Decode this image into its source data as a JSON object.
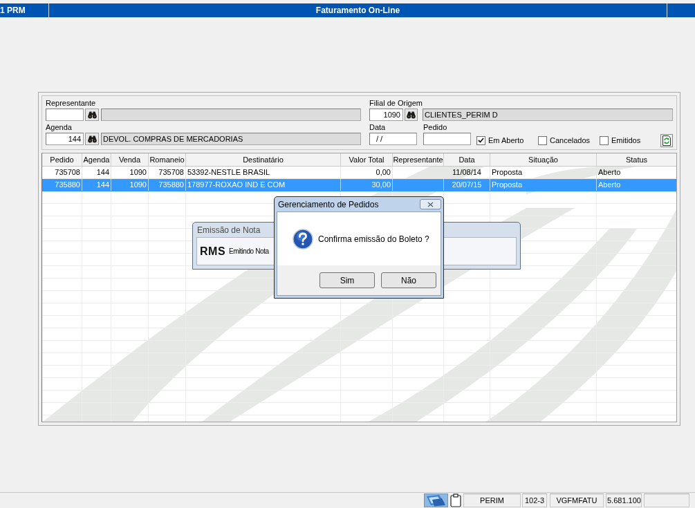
{
  "title_bar": {
    "module": "1 PRM",
    "title": "Faturamento On-Line"
  },
  "filters": {
    "representante": {
      "label": "Representante"
    },
    "agenda": {
      "label": "Agenda",
      "code": "144",
      "description": "DEVOL. COMPRAS DE MERCADORIAS"
    },
    "filial_de_origem": {
      "label": "Filial de Origem",
      "code": "1090",
      "description": "CLIENTES_PERIM D"
    },
    "data": {
      "label": "Data",
      "value": "/ /"
    },
    "pedido": {
      "label": "Pedido"
    },
    "checkboxes": [
      {
        "label": "Em Aberto",
        "checked": true
      },
      {
        "label": "Cancelados",
        "checked": false
      },
      {
        "label": "Emitidos",
        "checked": false
      }
    ]
  },
  "table": {
    "columns": [
      "Pedido",
      "Agenda",
      "Venda",
      "Romaneio",
      "Destinatário",
      "Valor Total",
      "Representante",
      "Data",
      "Situação",
      "Status"
    ],
    "rows": [
      {
        "selected": false,
        "pedido": "735708",
        "agenda": "144",
        "venda": "1090",
        "romaneio": "735708",
        "destinatario": "53392-NESTLE BRASIL",
        "valor_total": "0,00",
        "data": "11/08/14",
        "situacao": "Proposta",
        "status": "Aberto"
      },
      {
        "selected": true,
        "pedido": "735880",
        "agenda": "144",
        "venda": "1090",
        "romaneio": "735880",
        "destinatario": "178977-ROXAO IND E COM",
        "valor_total": "30,00",
        "data": "20/07/15",
        "situacao": "Proposta",
        "status": "Aberto"
      }
    ]
  },
  "background_dialog": {
    "title": "Emissão de Nota",
    "logo": "RMS",
    "message": "Emitindo Nota"
  },
  "dialog": {
    "title": "Gerenciamento de Pedidos",
    "message": "Confirma emissão do Boleto ?",
    "buttons": [
      {
        "label": "Sim"
      },
      {
        "label": "Não"
      }
    ]
  },
  "status_bar": {
    "cells": [
      "PERIM",
      "102-3",
      "VGFMFATU",
      "5.681.100"
    ]
  }
}
